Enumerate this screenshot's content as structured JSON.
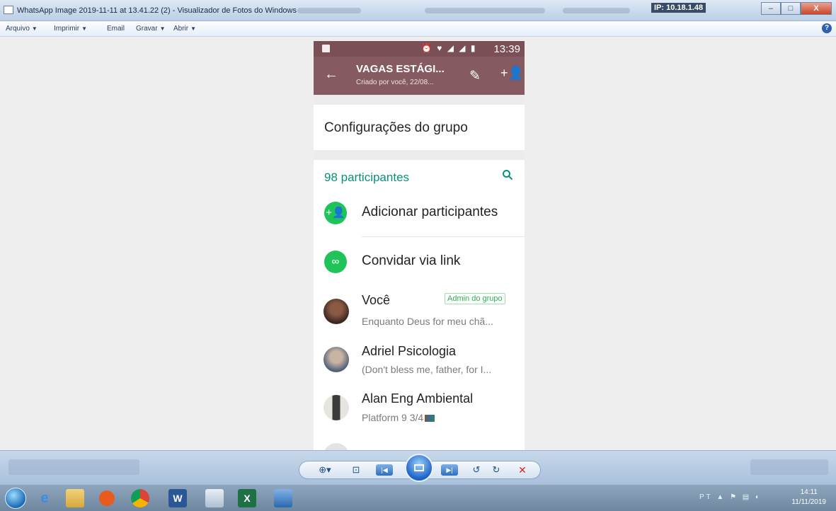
{
  "window": {
    "title": "WhatsApp Image 2019-11-11 at 13.41.22 (2) - Visualizador de Fotos do Windows",
    "ip_badge": "IP: 10.18.1.48",
    "buttons": {
      "minimize": "–",
      "maximize": "□",
      "close": "X"
    }
  },
  "menubar": {
    "items": [
      {
        "label": "Arquivo",
        "dropdown": true
      },
      {
        "label": "Imprimir",
        "dropdown": true
      },
      {
        "label": "Email",
        "dropdown": false
      },
      {
        "label": "Gravar",
        "dropdown": true
      },
      {
        "label": "Abrir",
        "dropdown": true
      }
    ],
    "arrow": "▼",
    "help": "?"
  },
  "phone": {
    "status_icons": "⏰ ♥ ◢ ◢ ▮",
    "time": "13:39",
    "appbar": {
      "back": "←",
      "group_name": "VAGAS ESTÁGI...",
      "group_subtitle": "Criado por você, 22/08...",
      "edit_icon": "✎",
      "add_participant_icon": "+👤"
    },
    "settings_label": "Configurações do grupo",
    "participants_count": "98 participantes",
    "search_icon": "🔍",
    "actions": [
      {
        "label": "Adicionar participantes",
        "icon": "+👤"
      },
      {
        "label": "Convidar via link",
        "icon": "∞"
      }
    ],
    "members": [
      {
        "name": "Você",
        "status": "Enquanto Deus for meu chã...",
        "badge": "Admin do grupo"
      },
      {
        "name": "Adriel Psicologia",
        "status": "(Don't bless me, father, for I..."
      },
      {
        "name": "Alan Eng Ambiental",
        "status": "Platform 9 3/4"
      }
    ]
  },
  "controls": {
    "zoom": "⊕▾",
    "fit": "⊡",
    "prev": "|◀",
    "next": "▶|",
    "rotate_ccw": "↺",
    "rotate_cw": "↻",
    "delete": "✕"
  },
  "taskbar": {
    "tray_lang": "PT",
    "clock_time": "14:11",
    "clock_date": "11/11/2019"
  }
}
